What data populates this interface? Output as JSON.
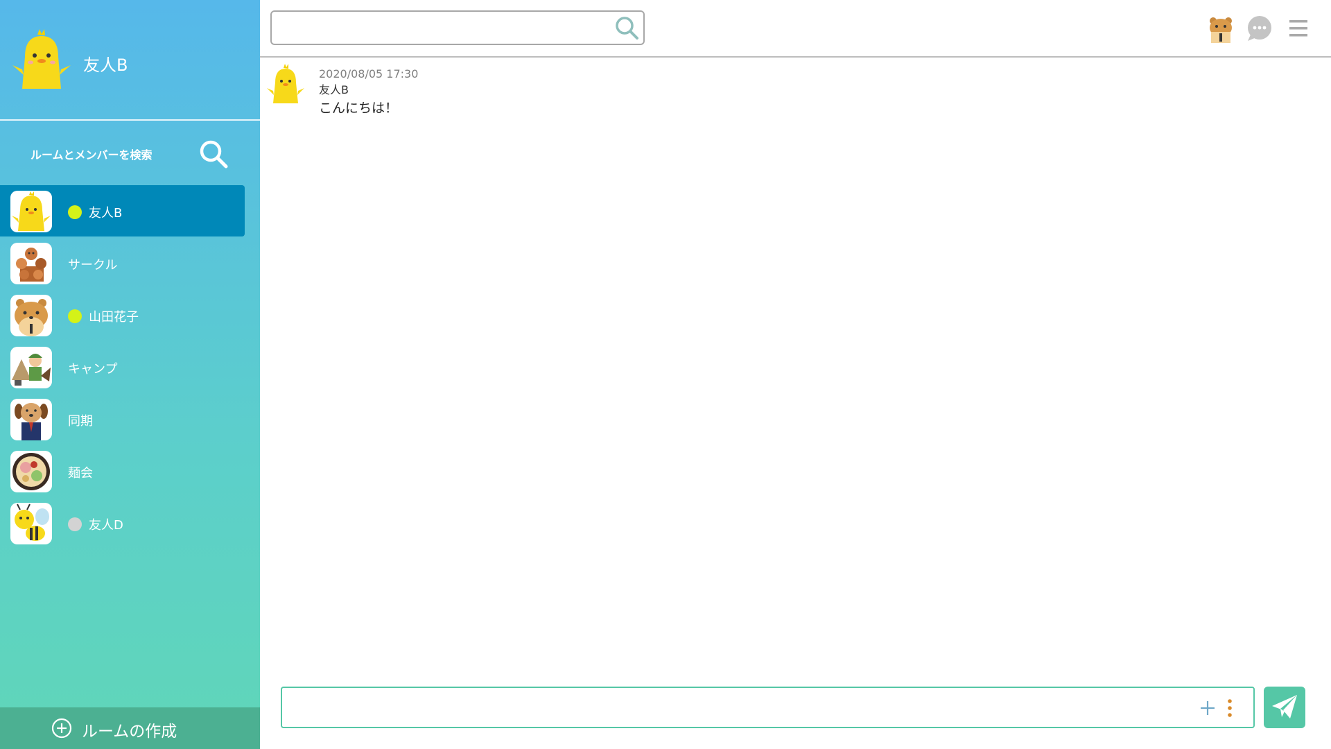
{
  "profile": {
    "name": "友人B"
  },
  "sidebar": {
    "search_label": "ルームとメンバーを検索",
    "rooms": [
      {
        "name": "友人B",
        "avatar": "chick-icon",
        "status": "online",
        "active": true
      },
      {
        "name": "サークル",
        "avatar": "group-animals-icon",
        "status": "none",
        "active": false
      },
      {
        "name": "山田花子",
        "avatar": "hamster-icon",
        "status": "online",
        "active": false
      },
      {
        "name": "キャンプ",
        "avatar": "camper-icon",
        "status": "none",
        "active": false
      },
      {
        "name": "同期",
        "avatar": "dog-businessman-icon",
        "status": "none",
        "active": false
      },
      {
        "name": "麺会",
        "avatar": "ramen-bowl-icon",
        "status": "none",
        "active": false
      },
      {
        "name": "友人D",
        "avatar": "bee-icon",
        "status": "offline",
        "active": false
      }
    ],
    "create_room_label": "ルームの作成"
  },
  "topbar": {
    "search_value": "",
    "search_placeholder": ""
  },
  "messages": [
    {
      "timestamp": "2020/08/05 17:30",
      "sender": "友人B",
      "text": "こんにちは！"
    }
  ],
  "composer": {
    "value": "",
    "placeholder": ""
  },
  "colors": {
    "sidebar_top": "#56b8ea",
    "sidebar_bottom": "#60d6b8",
    "active_room": "#0088b8",
    "online": "#d4f218",
    "offline": "#d3d3d3",
    "accent": "#55c7a6",
    "create_bar": "#4cb092"
  }
}
